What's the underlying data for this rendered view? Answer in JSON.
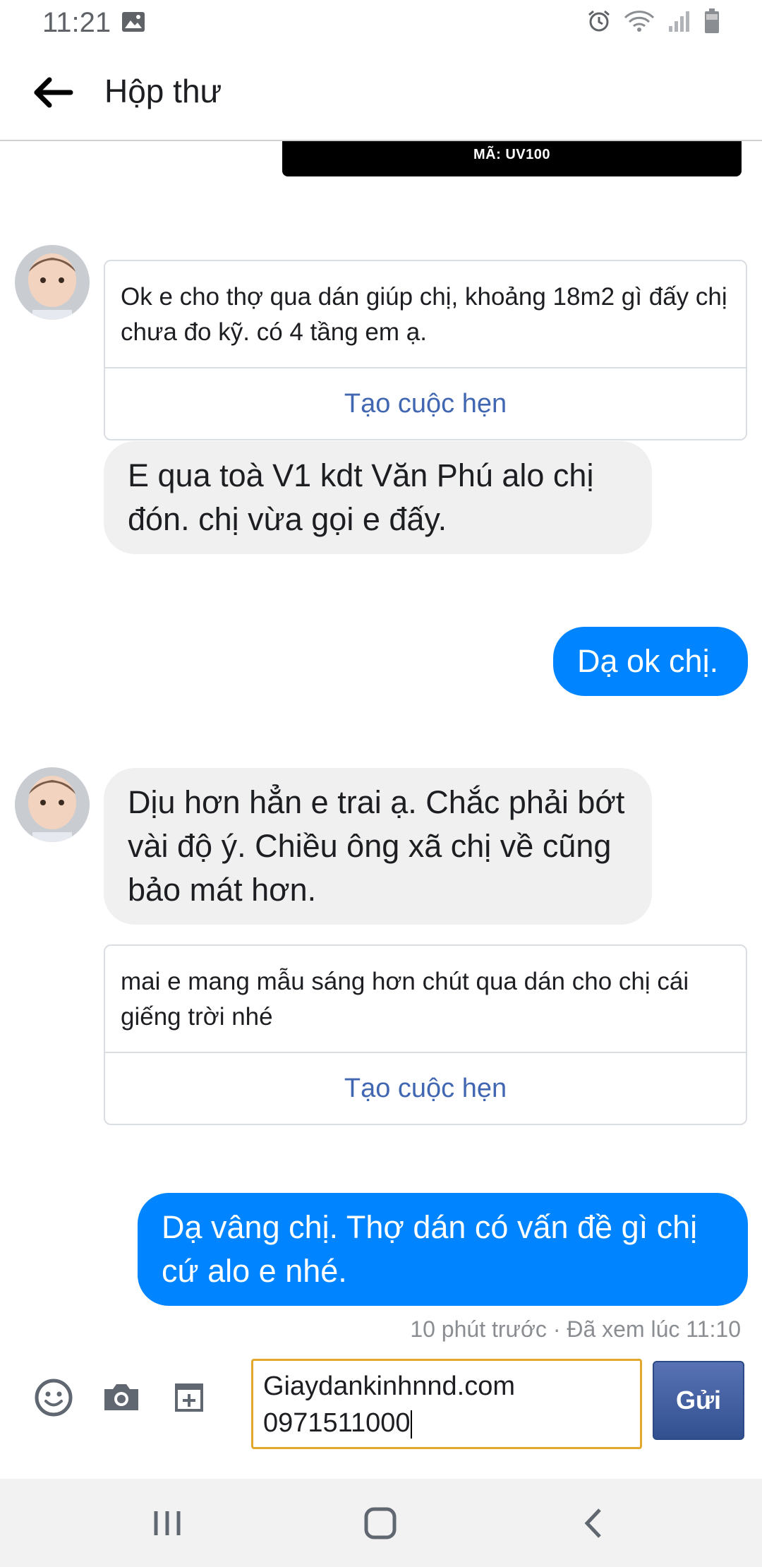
{
  "status_bar": {
    "time": "11:21"
  },
  "header": {
    "title": "Hộp thư"
  },
  "image_caption": "MÃ: UV100",
  "messages": {
    "card1": {
      "text": "Ok e cho thợ qua dán giúp chị, khoảng 18m2 gì đấy chị chưa đo kỹ. có 4 tầng em ạ.",
      "action": "Tạo cuộc hẹn"
    },
    "in1": "E qua toà V1 kdt Văn Phú alo chị đón. chị vừa gọi e đấy.",
    "out1": "Dạ ok chị.",
    "in2": "Dịu hơn hẳn e trai ạ. Chắc phải bớt vài độ ý. Chiều ông xã chị về cũng bảo mát hơn.",
    "card2": {
      "text": "mai e mang mẫu sáng hơn chút qua dán cho chị cái giếng trời nhé",
      "action": "Tạo cuộc hẹn"
    },
    "out2": "Dạ vâng chị. Thợ dán có vấn đề gì chị cứ alo e nhé."
  },
  "seen_status": "10 phút trước · Đã xem lúc 11:10",
  "composer": {
    "input_line1": "Giaydankinhnnd.com",
    "input_line2": "0971511000",
    "send_label": "Gửi"
  },
  "icons": {
    "back": "arrow-left-icon",
    "emoji": "emoji-icon",
    "camera": "camera-icon",
    "attach": "add-attachment-icon"
  },
  "colors": {
    "outgoing_bubble": "#0084ff",
    "incoming_bubble": "#f0f0f0",
    "link": "#4267b2",
    "input_border": "#e2a82c",
    "send_button": "#3b5998"
  }
}
